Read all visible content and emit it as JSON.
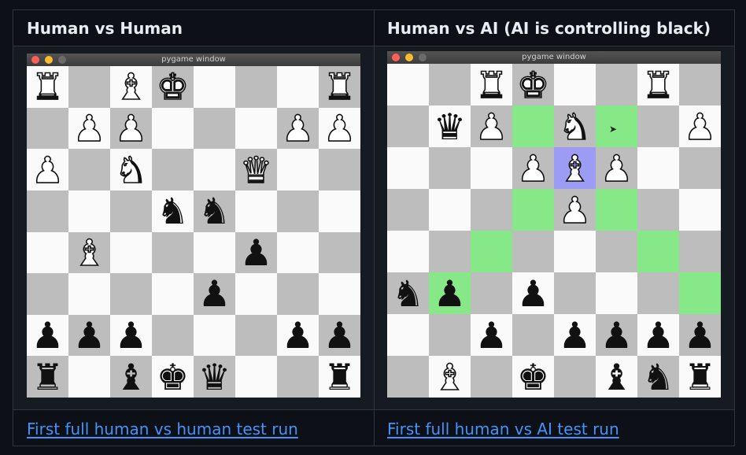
{
  "columns": [
    {
      "header": "Human vs Human",
      "link": "First full human vs human test run",
      "window_title": "pygame window",
      "board": [
        [
          "wR",
          "",
          "wB",
          "wK",
          "",
          "",
          "",
          "wR"
        ],
        [
          "",
          "wP",
          "wP",
          "",
          "",
          "",
          "wP",
          "wP"
        ],
        [
          "wP",
          "",
          "wN",
          "",
          "",
          "wQ",
          "",
          ""
        ],
        [
          "",
          "",
          "",
          "bN",
          "bN",
          "",
          "",
          ""
        ],
        [
          "",
          "wB",
          "",
          "",
          "",
          "bP",
          "",
          ""
        ],
        [
          "",
          "",
          "",
          "",
          "bP",
          "",
          "",
          ""
        ],
        [
          "bP",
          "bP",
          "bP",
          "",
          "",
          "",
          "bP",
          "bP"
        ],
        [
          "bR",
          "",
          "bB",
          "bK",
          "bQ",
          "",
          "",
          "bR"
        ]
      ]
    },
    {
      "header": "Human vs AI (AI is controlling black)",
      "link": "First full human vs AI test run",
      "window_title": "pygame window",
      "board": [
        [
          "",
          "",
          "wR",
          "wK",
          "",
          "",
          "wR",
          ""
        ],
        [
          "",
          "bQ",
          "wP",
          "",
          "wN",
          "",
          "",
          "wP"
        ],
        [
          "",
          "",
          "",
          "wP",
          "wB",
          "wP",
          "",
          ""
        ],
        [
          "",
          "",
          "",
          "",
          "wP",
          "",
          "",
          ""
        ],
        [
          "",
          "",
          "",
          "",
          "",
          "",
          "",
          ""
        ],
        [
          "bN",
          "bP",
          "",
          "bP",
          "",
          "",
          "",
          ""
        ],
        [
          "",
          "",
          "bP",
          "",
          "bP",
          "bP",
          "bP",
          "bP"
        ],
        [
          "",
          "wB",
          "",
          "bK",
          "",
          "bB",
          "bN",
          "bR"
        ]
      ],
      "highlights": {
        "green": [
          [
            1,
            3
          ],
          [
            1,
            5
          ],
          [
            3,
            3
          ],
          [
            3,
            5
          ],
          [
            4,
            2
          ],
          [
            4,
            6
          ],
          [
            5,
            1
          ],
          [
            5,
            7
          ]
        ],
        "blue": [
          [
            2,
            4
          ]
        ]
      }
    }
  ],
  "colors": {
    "page_bg": "#0d1117",
    "cell_bg": "#161b22",
    "border": "#30363d",
    "header_text": "#e6edf3",
    "link": "#4493f8",
    "board_light": "#fafafa",
    "board_dark": "#bdbdbd",
    "move_highlight": "#86e886",
    "selected_highlight": "#9c9cf4"
  },
  "glyphs": {
    "K": "♚",
    "Q": "♛",
    "R": "♜",
    "B": "♝",
    "N": "♞",
    "P": "♟"
  },
  "piece_names": {
    "K": "king",
    "Q": "queen",
    "R": "rook",
    "B": "bishop",
    "N": "knight",
    "P": "pawn"
  }
}
